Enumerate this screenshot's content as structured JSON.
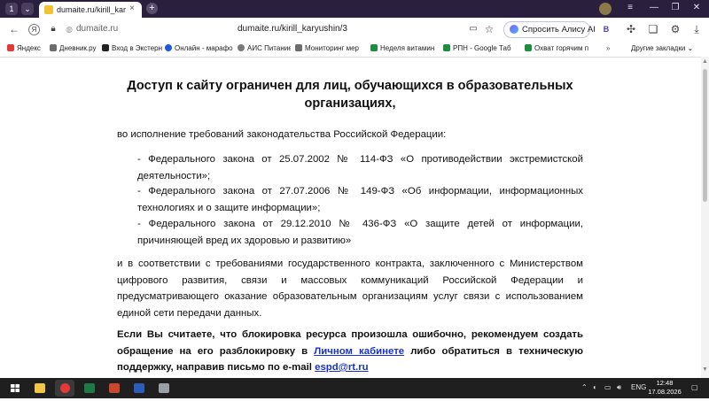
{
  "titlebar": {
    "tab_counter": "1",
    "tab_title": "dumaite.ru/kirill_karyus",
    "tab_close": "×",
    "new_tab": "+",
    "minimize": "—",
    "restore": "❐",
    "close": "✕"
  },
  "addressbar": {
    "domain": "dumaite.ru",
    "url": "dumaite.ru/kirill_karyushin/3",
    "alice_label": "Спросить Алису AI",
    "icons": [
      "back-icon",
      "yandex-icon",
      "lock-icon",
      "bookmark-icon",
      "extensions-icon",
      "downloads-icon"
    ]
  },
  "bookmarks": {
    "items": [
      {
        "label": "Яндекс",
        "color": "#e53935"
      },
      {
        "label": "Дневник.ру",
        "color": "#6d6d6d"
      },
      {
        "label": "Вход в Экстерн",
        "color": "#222222"
      },
      {
        "label": "Онлайн - марафо",
        "color": "#1e5bd6"
      },
      {
        "label": "АИС Питание",
        "color": "#7a7a7a"
      },
      {
        "label": "Мониторинг мер",
        "color": "#6d6d6d"
      },
      {
        "label": "Неделя витамин",
        "color": "#1e8e3e"
      },
      {
        "label": "РПН - Google Таб",
        "color": "#1e8e3e"
      },
      {
        "label": "Охват горячим п",
        "color": "#1e8e3e"
      }
    ],
    "other": "Другие закладки"
  },
  "page": {
    "heading": "Доступ к сайту ограничен для лиц, обучающихся в образовательных организациях,",
    "intro": "во исполнение требований законодательства Российской Федерации:",
    "law1": "- Федерального закона от 25.07.2002 № 114-ФЗ «О противодействии экстремистской деятельности»;",
    "law2": "- Федерального закона от 27.07.2006 № 149-ФЗ «Об информации, информационных технологиях и о защите информации»;",
    "law3": "- Федерального закона от 29.12.2010 № 436-ФЗ «О защите детей от информации, причиняющей вред их здоровью и развитию»",
    "contract": "и в соответствии с требованиями государственного контракта, заключенного с Министерством цифрового развития, связи и массовых коммуникаций Российской Федерации и предусматривающего оказание образовательным организациям услуг связи с использованием единой сети передачи данных.",
    "notice_before": "Если Вы считаете, что блокировка ресурса произошла ошибочно, рекомендуем создать обращение на его разблокировку в ",
    "notice_link": "Личном кабинете",
    "notice_middle": " либо обратиться в техническую поддержку, направив письмо по e-mail ",
    "notice_email": "espd@rt.ru"
  },
  "taskbar": {
    "lang": "ENG",
    "time": "12:48",
    "date": "17.08.2026"
  }
}
